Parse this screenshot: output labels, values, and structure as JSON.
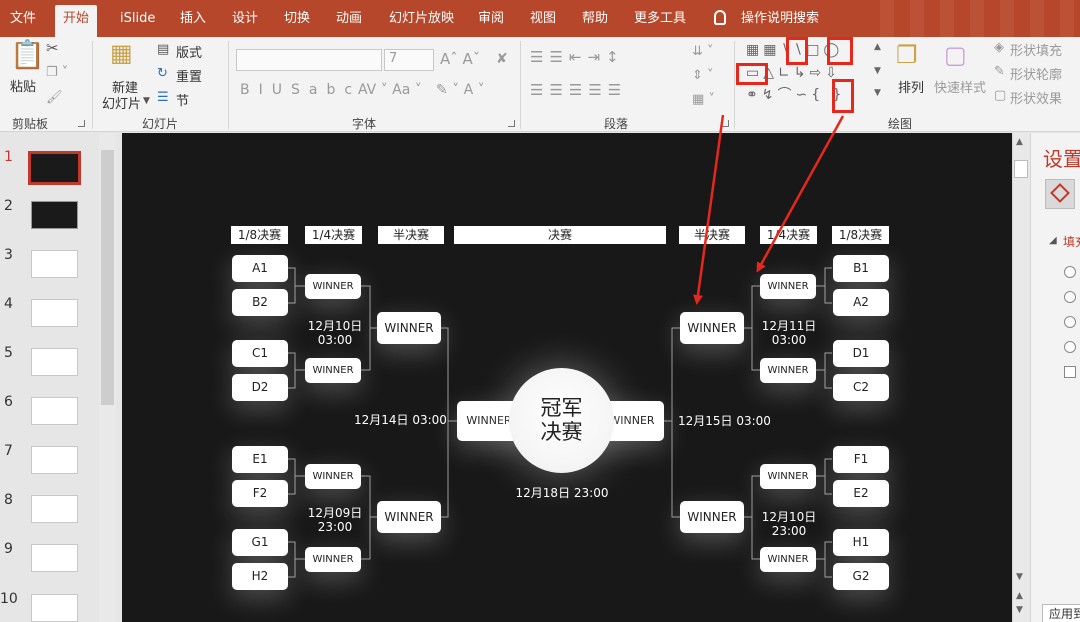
{
  "colors": {
    "accent": "#b7472a",
    "highlight_red": "#e8271c",
    "slide_bg": "#181818"
  },
  "menu": {
    "tabs": [
      "文件",
      "开始",
      "iSlide",
      "插入",
      "设计",
      "切换",
      "动画",
      "幻灯片放映",
      "审阅",
      "视图",
      "帮助",
      "更多工具"
    ],
    "search": "操作说明搜索"
  },
  "ribbon": {
    "clipboard": {
      "paste": "粘贴",
      "label": "剪贴板"
    },
    "slides": {
      "new_slide": "新建",
      "new_slide2": "幻灯片",
      "layout": "版式",
      "reset": "重置",
      "section": "节",
      "label": "幻灯片"
    },
    "font": {
      "size": "7",
      "label": "字体"
    },
    "paragraph": {
      "label": "段落"
    },
    "drawing": {
      "arrange": "排列",
      "quick_style": "快速样式",
      "fill": "形状填充",
      "outline": "形状轮廓",
      "effect": "形状效果",
      "label": "绘图"
    }
  },
  "thumbnails": [
    "1",
    "2",
    "3",
    "4",
    "5",
    "6",
    "7",
    "8",
    "9",
    "10"
  ],
  "slide": {
    "headers": {
      "left_r16": "1/8决赛",
      "left_qf": "1/4决赛",
      "left_sf": "半决赛",
      "final": "决赛",
      "right_sf": "半决赛",
      "right_qf": "1/4决赛",
      "right_r16": "1/8决赛"
    },
    "left_teams": [
      "A1",
      "B2",
      "C1",
      "D2",
      "E1",
      "F2",
      "G1",
      "H2"
    ],
    "right_teams": [
      "B1",
      "A2",
      "D1",
      "C2",
      "F1",
      "E2",
      "H1",
      "G2"
    ],
    "winner": "WINNER",
    "dates": {
      "left_top_qf": [
        "12月10日",
        "03:00"
      ],
      "left_bottom_qf": [
        "12月09日",
        "23:00"
      ],
      "right_top_qf": [
        "12月11日",
        "03:00"
      ],
      "right_bottom_qf": [
        "12月10日",
        "23:00"
      ],
      "left_semi": "12月14日 03:00",
      "right_semi": "12月15日 03:00",
      "final": "12月18日 23:00"
    },
    "champion": [
      "冠军",
      "决赛"
    ]
  },
  "right_pane": {
    "title": "设置",
    "fill_section": "填充",
    "apply": "应用到"
  }
}
